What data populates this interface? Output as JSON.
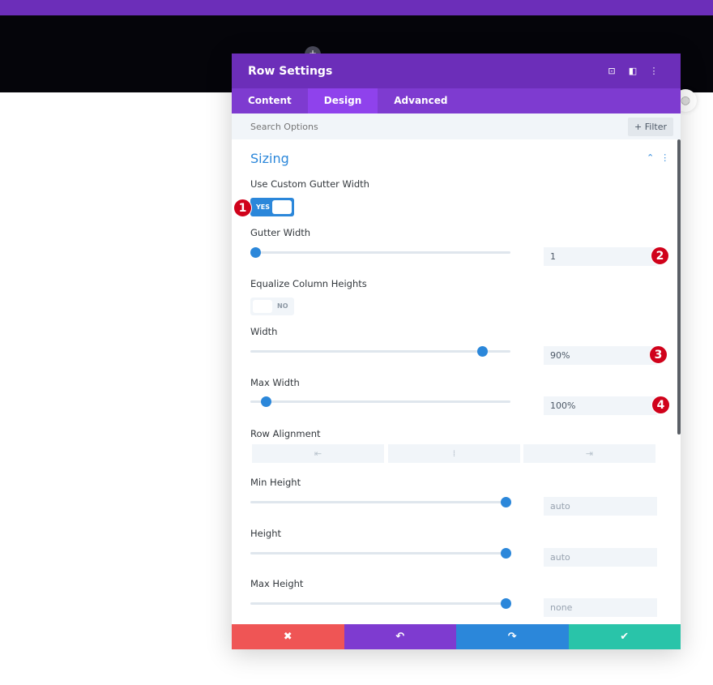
{
  "modal": {
    "title": "Row Settings",
    "tabs": [
      "Content",
      "Design",
      "Advanced"
    ],
    "active_tab": "Design"
  },
  "search": {
    "placeholder": "Search Options",
    "filter_label": "+ Filter"
  },
  "section": {
    "title": "Sizing"
  },
  "fields": {
    "custom_gutter": {
      "label": "Use Custom Gutter Width",
      "value": "YES"
    },
    "gutter_width": {
      "label": "Gutter Width",
      "value": "1",
      "slider_percent": 2
    },
    "equalize": {
      "label": "Equalize Column Heights",
      "value": "NO"
    },
    "width": {
      "label": "Width",
      "value": "90%",
      "slider_percent": 89
    },
    "max_width": {
      "label": "Max Width",
      "value": "100%",
      "slider_percent": 6
    },
    "row_alignment": {
      "label": "Row Alignment",
      "options": [
        "left",
        "center",
        "right"
      ]
    },
    "min_height": {
      "label": "Min Height",
      "placeholder": "auto",
      "slider_percent": 98
    },
    "height": {
      "label": "Height",
      "placeholder": "auto",
      "slider_percent": 98
    },
    "max_height": {
      "label": "Max Height",
      "placeholder": "none",
      "slider_percent": 98
    }
  },
  "badges": [
    "1",
    "2",
    "3",
    "4"
  ],
  "colors": {
    "purple": "#6c2eb9",
    "blue": "#2b87da",
    "red": "#ef5555",
    "violet": "#7e3bd0",
    "green": "#29c4a9",
    "badge": "#d0021b"
  }
}
